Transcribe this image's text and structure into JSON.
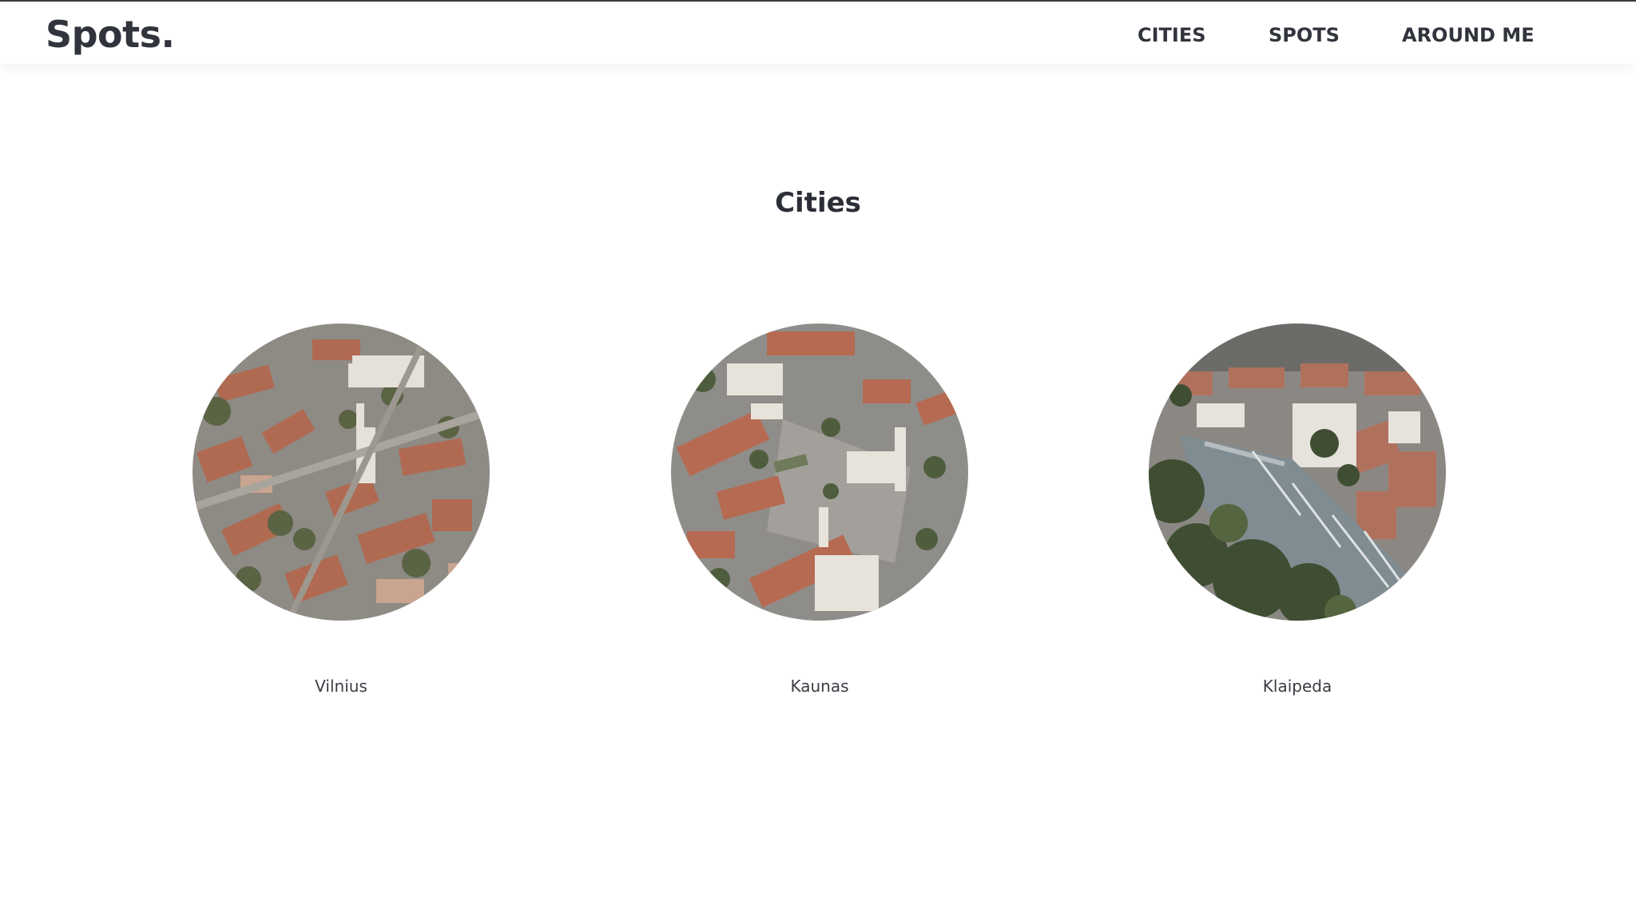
{
  "brand": {
    "logo": "Spots."
  },
  "nav": {
    "items": [
      {
        "label": "CITIES"
      },
      {
        "label": "SPOTS"
      },
      {
        "label": "AROUND ME"
      }
    ]
  },
  "main": {
    "title": "Cities",
    "cities": [
      {
        "name": "Vilnius"
      },
      {
        "name": "Kaunas"
      },
      {
        "name": "Klaipeda"
      }
    ]
  },
  "colors": {
    "text": "#31343c",
    "background": "#ffffff",
    "roof": "#b86a55",
    "tree": "#4b5a3e",
    "water": "#7d8a8f"
  }
}
